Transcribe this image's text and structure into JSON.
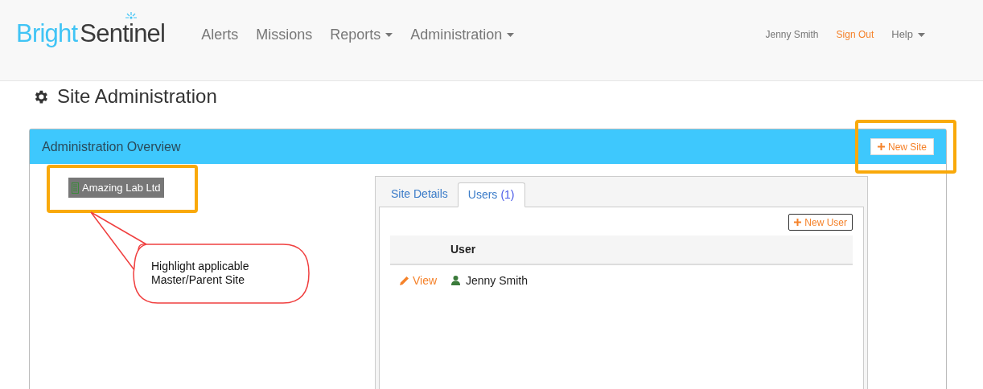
{
  "navbar": {
    "logo": {
      "part_1": "Bright",
      "part_2": "Sentinel"
    },
    "items": [
      {
        "label": "Alerts",
        "dropdown": false
      },
      {
        "label": "Missions",
        "dropdown": false
      },
      {
        "label": "Reports",
        "dropdown": true
      },
      {
        "label": "Administration",
        "dropdown": true
      }
    ],
    "user": "Jenny Smith",
    "sign_out": "Sign Out",
    "help": {
      "label": "Help",
      "dropdown": true
    }
  },
  "page_title": "Site Administration",
  "panel": {
    "title": "Administration Overview",
    "new_site_button": "New Site",
    "tree": [
      {
        "label": "Amazing Lab Ltd",
        "selected": true
      }
    ],
    "tabs": [
      {
        "label": "Site Details",
        "selected": false
      },
      {
        "label": "Users",
        "count": "(1)",
        "selected": true
      }
    ],
    "new_user_button": "New User",
    "table": {
      "columns": [
        "User"
      ],
      "rows": [
        {
          "action": "View",
          "name": "Jenny Smith"
        }
      ]
    }
  },
  "annotation": {
    "callout": "Highlight applicable Master/Parent Site"
  }
}
